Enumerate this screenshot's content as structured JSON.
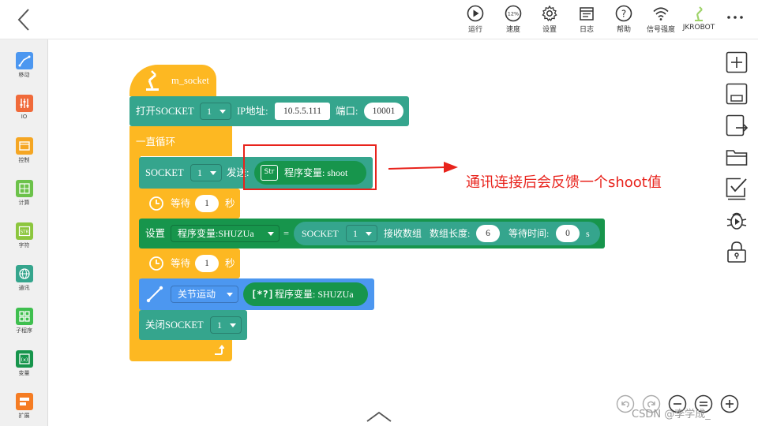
{
  "toolbar": {
    "items": [
      {
        "label": "运行",
        "icon": "play-icon"
      },
      {
        "label": "速度",
        "icon": "speed-icon",
        "speed_value": "12%"
      },
      {
        "label": "设置",
        "icon": "gear-icon"
      },
      {
        "label": "日志",
        "icon": "log-icon"
      },
      {
        "label": "帮助",
        "icon": "help-icon"
      },
      {
        "label": "信号强度",
        "icon": "wifi-icon"
      },
      {
        "label": "JKROBOT",
        "icon": "robot-arm-icon"
      }
    ]
  },
  "palette": {
    "items": [
      {
        "label": "移动",
        "color": "#4c97f0"
      },
      {
        "label": "IO",
        "color": "#f06a3a"
      },
      {
        "label": "控制",
        "color": "#f5a623"
      },
      {
        "label": "计算",
        "color": "#6cc24a"
      },
      {
        "label": "字符",
        "color": "#8cc63e"
      },
      {
        "label": "通讯",
        "color": "#35a58d"
      },
      {
        "label": "子程序",
        "color": "#3fbf4f"
      },
      {
        "label": "变量",
        "color": "#17954c"
      },
      {
        "label": "扩展",
        "color": "#f57c23"
      }
    ]
  },
  "program": {
    "hat_label": "m_socket",
    "open_socket": {
      "label": "打开SOCKET",
      "socket_id": "1",
      "ip_label": "IP地址:",
      "ip_value": "10.5.5.111",
      "port_label": "端口:",
      "port_value": "10001"
    },
    "loop_label": "一直循环",
    "send_socket": {
      "label": "SOCKET",
      "socket_id": "1",
      "send_label": "发送:",
      "var_badge": "Str",
      "var_label": "程序变量: shoot"
    },
    "wait1": {
      "label": "等待",
      "value": "1",
      "unit": "秒"
    },
    "set_block": {
      "label": "设置",
      "var_name": "程序变量:SHUZUa",
      "equals": "=",
      "socket_label": "SOCKET",
      "socket_id": "1",
      "recv_label": "接收数组",
      "len_label": "数组长度:",
      "len_value": "6",
      "timeout_label": "等待时间:",
      "timeout_value": "0",
      "timeout_unit": "s"
    },
    "wait2": {
      "label": "等待",
      "value": "1",
      "unit": "秒"
    },
    "joint_move": {
      "mode": "关节运动",
      "var_badge": "[*?]",
      "var_label": "程序变量: SHUZUa"
    },
    "close_socket": {
      "label": "关闭SOCKET",
      "socket_id": "1"
    }
  },
  "annotation": {
    "text": "通讯连接后会反馈一个shoot值",
    "color": "#e8231c"
  },
  "watermark": "CSDN @李学成_",
  "colors": {
    "control_yellow": "#fdb822",
    "comm_teal": "#35a58d",
    "move_blue": "#4c97f0",
    "var_green": "#17954c"
  }
}
